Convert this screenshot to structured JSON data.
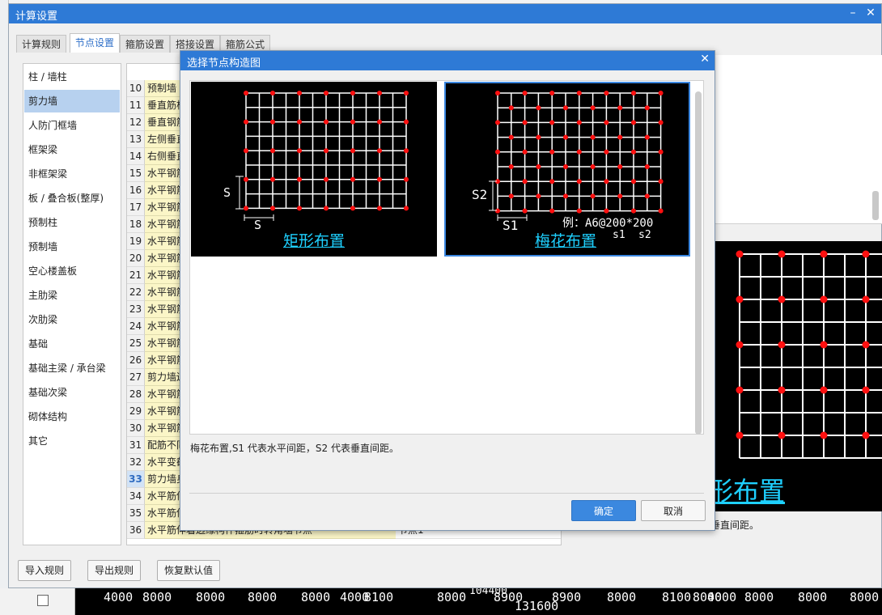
{
  "main_window": {
    "title": "计算设置",
    "minimize": "–",
    "close": "✕"
  },
  "tabs": [
    {
      "label": "计算规则"
    },
    {
      "label": "节点设置"
    },
    {
      "label": "箍筋设置"
    },
    {
      "label": "搭接设置"
    },
    {
      "label": "箍筋公式"
    }
  ],
  "categories": [
    {
      "label": "柱 / 墙柱"
    },
    {
      "label": "剪力墙"
    },
    {
      "label": "人防门框墙"
    },
    {
      "label": "框架梁"
    },
    {
      "label": "非框架梁"
    },
    {
      "label": "板 / 叠合板(整厚)"
    },
    {
      "label": "预制柱"
    },
    {
      "label": "预制墙"
    },
    {
      "label": "空心楼盖板"
    },
    {
      "label": "主肋梁"
    },
    {
      "label": "次肋梁"
    },
    {
      "label": "基础"
    },
    {
      "label": "基础主梁 / 承台梁"
    },
    {
      "label": "基础次梁"
    },
    {
      "label": "砌体结构"
    },
    {
      "label": "其它"
    }
  ],
  "table": {
    "rows": [
      {
        "num": "10",
        "name": "预制墙"
      },
      {
        "num": "11",
        "name": "垂直筋构"
      },
      {
        "num": "12",
        "name": "垂直钢筋"
      },
      {
        "num": "13",
        "name": "左侧垂直"
      },
      {
        "num": "14",
        "name": "右侧垂直"
      },
      {
        "num": "15",
        "name": "水平钢筋"
      },
      {
        "num": "16",
        "name": "水平钢筋"
      },
      {
        "num": "17",
        "name": "水平钢筋"
      },
      {
        "num": "18",
        "name": "水平钢筋"
      },
      {
        "num": "19",
        "name": "水平钢筋"
      },
      {
        "num": "20",
        "name": "水平钢筋"
      },
      {
        "num": "21",
        "name": "水平钢筋"
      },
      {
        "num": "22",
        "name": "水平钢筋"
      },
      {
        "num": "23",
        "name": "水平钢筋"
      },
      {
        "num": "24",
        "name": "水平钢筋"
      },
      {
        "num": "25",
        "name": "水平钢筋"
      },
      {
        "num": "26",
        "name": "水平钢筋"
      },
      {
        "num": "27",
        "name": "剪力墙边"
      },
      {
        "num": "28",
        "name": "水平钢筋"
      },
      {
        "num": "29",
        "name": "水平钢筋"
      },
      {
        "num": "30",
        "name": "水平钢筋"
      },
      {
        "num": "31",
        "name": "配筋不同"
      },
      {
        "num": "32",
        "name": "水平变截"
      },
      {
        "num": "33",
        "name": "剪力墙身"
      },
      {
        "num": "34",
        "name": "水平筋伸"
      },
      {
        "num": "35",
        "name": "水平筋伸"
      },
      {
        "num": "36",
        "name": "水平筋伸着边缘构件箍筋时转角墙节点",
        "value": "节点1"
      }
    ],
    "selected": "33"
  },
  "right_preview": {
    "label": "形布置",
    "desc": "表垂直间距。"
  },
  "bottom_buttons": {
    "import": "导入规则",
    "export": "导出规则",
    "restore": "恢复默认值"
  },
  "cad_strip": [
    "4000",
    "8000",
    "8000",
    "8000",
    "8000",
    "4000",
    "8100",
    "8000",
    "8900",
    "8900",
    "8000",
    "8100",
    "8000",
    "4000",
    "8000",
    "8000",
    "8000",
    "104400",
    "131600"
  ],
  "dialog": {
    "title": "选择节点构造图",
    "close": "✕",
    "options": [
      {
        "label": "矩形布置",
        "dim_v": "S",
        "dim_h": "S"
      },
      {
        "label": "梅花布置",
        "dim_v": "S2",
        "dim_h": "S1",
        "example": "例：A6@200*200",
        "s1": "s1",
        "s2": "s2"
      }
    ],
    "description": "梅花布置,S1 代表水平间距，S2 代表垂直间距。",
    "ok": "确定",
    "cancel": "取消"
  },
  "colors": {
    "accent": "#2e7ad6",
    "rebar_dot": "#ff1010",
    "label_cyan": "#1ed0ff",
    "highlight_row": "#fbf6c7"
  }
}
